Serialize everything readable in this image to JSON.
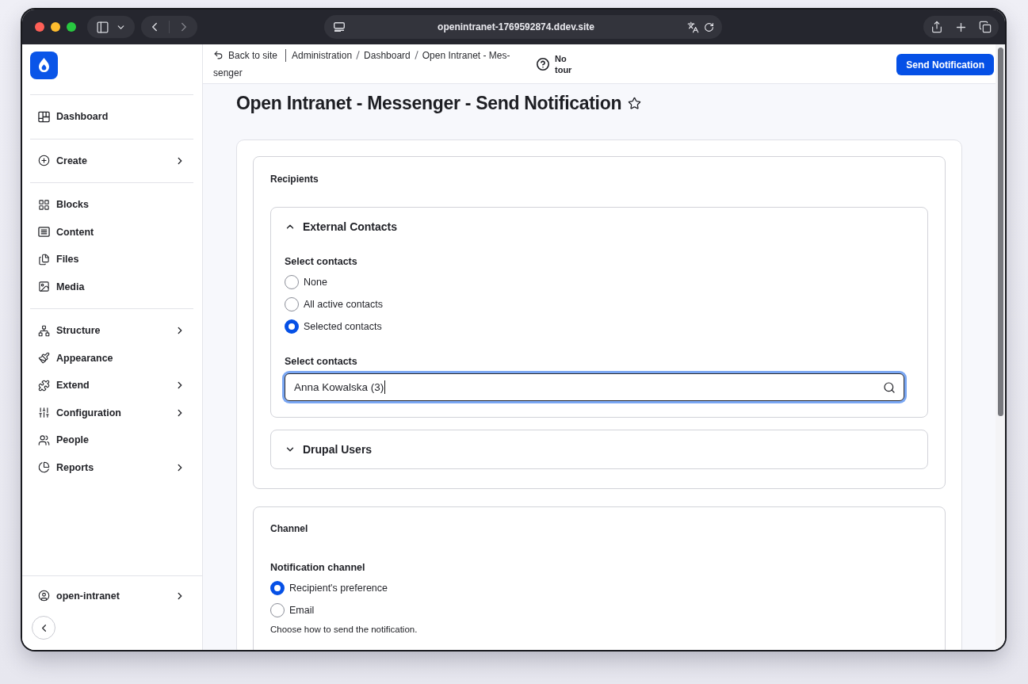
{
  "browser": {
    "url": "openintranet-1769592874.ddev.site"
  },
  "sidebar": {
    "sections": [
      {
        "items": [
          {
            "label": "Dashboard",
            "has_submenu": false
          }
        ]
      },
      {
        "items": [
          {
            "label": "Create",
            "has_submenu": true
          }
        ]
      },
      {
        "items": [
          {
            "label": "Blocks",
            "has_submenu": false
          },
          {
            "label": "Content",
            "has_submenu": false
          },
          {
            "label": "Files",
            "has_submenu": false
          },
          {
            "label": "Media",
            "has_submenu": false
          }
        ]
      },
      {
        "items": [
          {
            "label": "Structure",
            "has_submenu": true
          },
          {
            "label": "Appearance",
            "has_submenu": false
          },
          {
            "label": "Extend",
            "has_submenu": true
          },
          {
            "label": "Configuration",
            "has_submenu": true
          },
          {
            "label": "People",
            "has_submenu": false
          },
          {
            "label": "Reports",
            "has_submenu": true
          }
        ]
      }
    ],
    "account": {
      "label": "open-intranet",
      "has_submenu": true
    }
  },
  "header": {
    "back_link": "Back to site",
    "breadcrumbs": [
      {
        "lines": [
          "Administration"
        ]
      },
      {
        "lines": [
          "Dashboard"
        ]
      },
      {
        "lines": [
          "Open Intranet - Mes-",
          "senger"
        ]
      }
    ],
    "tour": "No tour",
    "action_button": "Send Notification"
  },
  "page": {
    "title": "Open Intranet - Messenger - Send Notification",
    "starred": false
  },
  "recipients": {
    "legend": "Recipients",
    "groups": [
      {
        "title": "External Contacts",
        "expanded": true,
        "radio_label": "Select contacts",
        "options": [
          {
            "label": "None",
            "selected": false
          },
          {
            "label": "All active contacts",
            "selected": false
          },
          {
            "label": "Selected contacts",
            "selected": true
          }
        ],
        "autocomplete": {
          "label": "Select contacts",
          "value": "Anna Kowalska (3)"
        }
      },
      {
        "title": "Drupal Users",
        "expanded": false
      }
    ]
  },
  "channel": {
    "legend": "Channel",
    "field_label": "Notification channel",
    "options": [
      {
        "label": "Recipient's preference",
        "selected": true
      },
      {
        "label": "Email",
        "selected": false
      }
    ],
    "description": "Choose how to send the notification."
  }
}
